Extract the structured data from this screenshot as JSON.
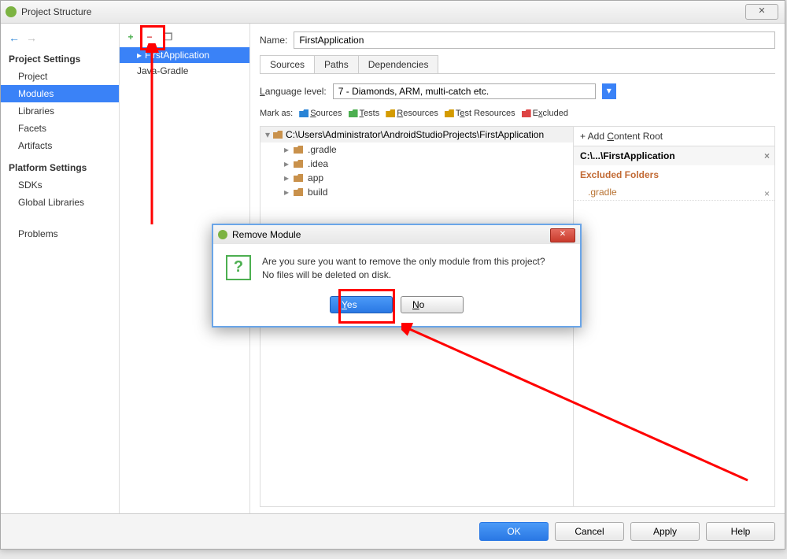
{
  "window": {
    "title": "Project Structure"
  },
  "sidebar": {
    "section1": "Project Settings",
    "items1": [
      "Project",
      "Modules",
      "Libraries",
      "Facets",
      "Artifacts"
    ],
    "selected1": 1,
    "section2": "Platform Settings",
    "items2": [
      "SDKs",
      "Global Libraries"
    ],
    "problems": "Problems"
  },
  "modules": {
    "items": [
      "FirstApplication",
      "Java-Gradle"
    ],
    "selected": 0
  },
  "content": {
    "name_label": "Name:",
    "name_value": "FirstApplication",
    "tabs": [
      "Sources",
      "Paths",
      "Dependencies"
    ],
    "active_tab": 0,
    "lang_label": "Language level:",
    "lang_value": "7 - Diamonds, ARM, multi-catch etc.",
    "mark_label": "Mark as:",
    "marks": [
      "Sources",
      "Tests",
      "Resources",
      "Test Resources",
      "Excluded"
    ],
    "root_path": "C:\\Users\\Administrator\\AndroidStudioProjects\\FirstApplication",
    "folders": [
      ".gradle",
      ".idea",
      "app",
      "build"
    ],
    "add_root": "+ Add Content Root",
    "content_root": "C:\\...\\FirstApplication",
    "excluded_head": "Excluded Folders",
    "excluded_items": [
      ".gradle"
    ]
  },
  "footer": {
    "ok": "OK",
    "cancel": "Cancel",
    "apply": "Apply",
    "help": "Help"
  },
  "dialog": {
    "title": "Remove Module",
    "line1": "Are you sure you want to remove the only module from this project?",
    "line2": "No files will be deleted on disk.",
    "yes": "Yes",
    "no": "No"
  }
}
